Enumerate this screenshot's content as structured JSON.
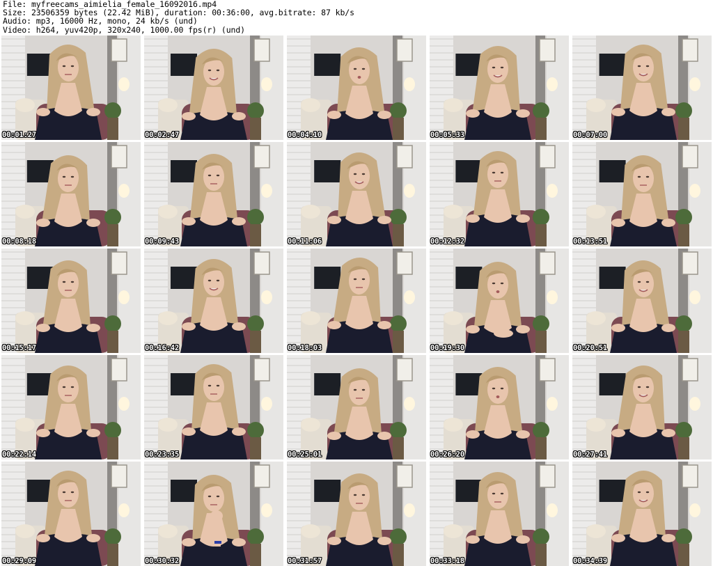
{
  "header": {
    "file_line": "File: myfreecams_aimielia_female_16092016.mp4",
    "size_line": "Size: 23506359 bytes (22.42 MiB), duration: 00:36:00, avg.bitrate: 87 kb/s",
    "audio_line": "Audio: mp3, 16000 Hz, mono, 24 kb/s (und)",
    "video_line": "Video: h264, yuv420p, 320x240, 1000.00 fps(r) (und)"
  },
  "thumbnails": [
    {
      "timestamp": "00:01:27",
      "pose": "neutral"
    },
    {
      "timestamp": "00:02:47",
      "pose": "smile"
    },
    {
      "timestamp": "00:04:10",
      "pose": "talk"
    },
    {
      "timestamp": "00:05:33",
      "pose": "smile"
    },
    {
      "timestamp": "00:07:00",
      "pose": "smile"
    },
    {
      "timestamp": "00:08:18",
      "pose": "neutral"
    },
    {
      "timestamp": "00:09:43",
      "pose": "neutral"
    },
    {
      "timestamp": "00:11:06",
      "pose": "smile"
    },
    {
      "timestamp": "00:12:32",
      "pose": "neutral"
    },
    {
      "timestamp": "00:13:51",
      "pose": "neutral"
    },
    {
      "timestamp": "00:15:17",
      "pose": "neutral"
    },
    {
      "timestamp": "00:16:42",
      "pose": "smile"
    },
    {
      "timestamp": "00:18:03",
      "pose": "neutral"
    },
    {
      "timestamp": "00:19:30",
      "pose": "kiss"
    },
    {
      "timestamp": "00:20:51",
      "pose": "smile"
    },
    {
      "timestamp": "00:22:14",
      "pose": "neutral"
    },
    {
      "timestamp": "00:23:35",
      "pose": "neutral"
    },
    {
      "timestamp": "00:25:01",
      "pose": "neutral"
    },
    {
      "timestamp": "00:26:20",
      "pose": "talk"
    },
    {
      "timestamp": "00:27:41",
      "pose": "smile"
    },
    {
      "timestamp": "00:29:09",
      "pose": "neutral"
    },
    {
      "timestamp": "00:30:32",
      "pose": "chin-hand"
    },
    {
      "timestamp": "00:31:57",
      "pose": "neutral"
    },
    {
      "timestamp": "00:33:18",
      "pose": "neutral"
    },
    {
      "timestamp": "00:34:39",
      "pose": "smile"
    }
  ],
  "colors": {
    "page_background": "#ffffff",
    "header_text": "#000000",
    "timestamp_text": "#ffffff",
    "timestamp_outline": "#000000",
    "wall": "#d9d6d3",
    "brick_wall": "#ecebea",
    "tv_screen": "#1c1f25",
    "hair": "#c7ab83",
    "skin": "#e8c5ad",
    "top": "#1a1c2e",
    "chair": "#7c4a52",
    "plant": "#4d6b3a"
  }
}
